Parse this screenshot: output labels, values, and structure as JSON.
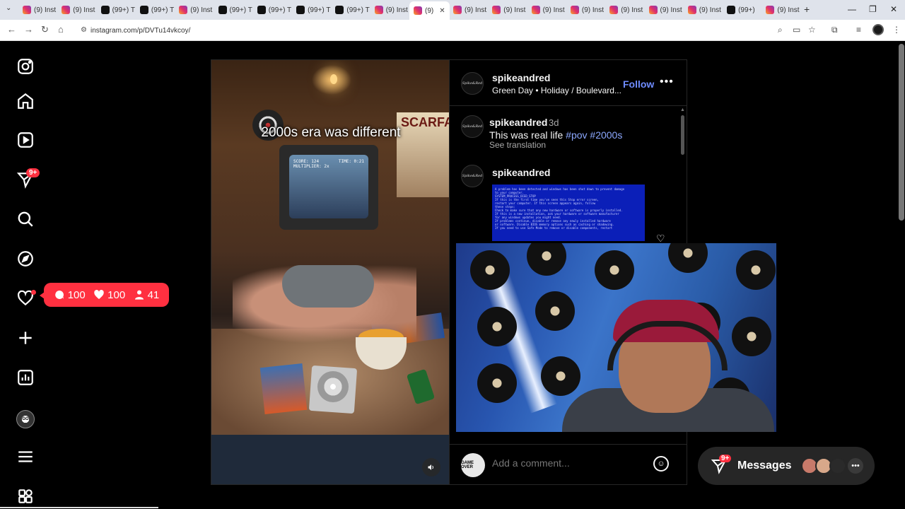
{
  "browser": {
    "tabs": [
      {
        "title": "(9) Inst",
        "icon": "instagram-icon"
      },
      {
        "title": "(9) Inst",
        "icon": "instagram-icon"
      },
      {
        "title": "(99+) T",
        "icon": "tiktok-icon"
      },
      {
        "title": "(99+) T",
        "icon": "tiktok-icon"
      },
      {
        "title": "(9) Inst",
        "icon": "instagram-icon"
      },
      {
        "title": "(99+) T",
        "icon": "tiktok-icon"
      },
      {
        "title": "(99+) T",
        "icon": "tiktok-icon"
      },
      {
        "title": "(99+) T",
        "icon": "tiktok-icon"
      },
      {
        "title": "(99+) T",
        "icon": "tiktok-icon"
      },
      {
        "title": "(9) Inst",
        "icon": "instagram-icon"
      },
      {
        "title": "(9)",
        "icon": "instagram-icon",
        "active": true
      },
      {
        "title": "(9) Inst",
        "icon": "instagram-icon"
      },
      {
        "title": "(9) Inst",
        "icon": "instagram-icon"
      },
      {
        "title": "(9) Inst",
        "icon": "instagram-icon"
      },
      {
        "title": "(9) Inst",
        "icon": "instagram-icon"
      },
      {
        "title": "(9) Inst",
        "icon": "instagram-icon"
      },
      {
        "title": "(9) Inst",
        "icon": "instagram-icon"
      },
      {
        "title": "(9) Inst",
        "icon": "instagram-icon"
      },
      {
        "title": "(99+)",
        "icon": "tiktok-icon"
      },
      {
        "title": "(9) Inst",
        "icon": "instagram-icon"
      }
    ],
    "url": "instagram.com/p/DVTu14vkcoy/"
  },
  "notification_pill": {
    "comments": "100",
    "likes": "100",
    "follows": "41"
  },
  "nav_badge": "9+",
  "post": {
    "overlay_text": "2000s era was different",
    "crt_score": "SCORE: 124\nMULTIPLIER: 2x",
    "crt_time": "TIME: 0:21",
    "poster_text": "SCARFACE",
    "header": {
      "username": "spikeandred",
      "subtitle": "Green Day • Holiday / Boulevard...",
      "follow_label": "Follow"
    },
    "caption": {
      "username": "spikeandred",
      "time": "3d",
      "text": "This was real life",
      "tags": "#pov #2000s",
      "see_translation": "See translation"
    },
    "comment2": {
      "username": "spikeandred"
    },
    "bsod_lines": [
      "A problem has been detected and windows has been shut down to prevent damage",
      "to your computer.",
      "",
      "SYSTEM_PROCESS_DIED_STOP",
      "",
      "If this is the first time you've seen this Stop error screen,",
      "restart your computer. If this screen appears again, follow",
      "these steps:",
      "",
      "Check to make sure that any new hardware or software is properly installed.",
      "If this is a new installation, ask your hardware or software manufacturer",
      "for any windows updates you might need.",
      "",
      "If problems continue, disable or remove any newly installed hardware",
      "or software. Disable BIOS memory options such as caching or shadowing.",
      "If you need to use Safe Mode to remove or disable components, restart"
    ],
    "comment_placeholder": "Add a comment..."
  },
  "messages": {
    "label": "Messages",
    "badge": "9+"
  },
  "colors": {
    "accent_blue": "#6f8cff",
    "badge_red": "#ff3040",
    "background": "#000000"
  }
}
